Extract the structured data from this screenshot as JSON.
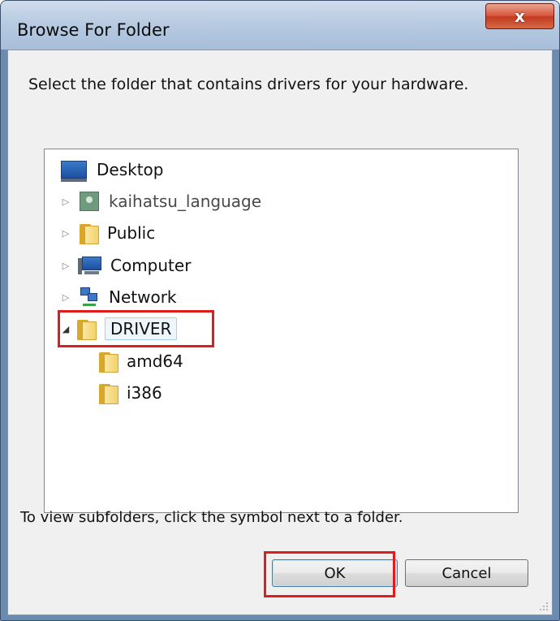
{
  "window": {
    "title": "Browse For Folder",
    "close_glyph": "x"
  },
  "instruction": "Select the folder that contains drivers for your hardware.",
  "tree": {
    "items": [
      {
        "label": "Desktop",
        "icon": "desktop-icon",
        "expander": ""
      },
      {
        "label": "kaihatsu_language",
        "icon": "user-folder-icon",
        "expander": "▷"
      },
      {
        "label": "Public",
        "icon": "folder-icon",
        "expander": "▷"
      },
      {
        "label": "Computer",
        "icon": "computer-icon",
        "expander": "▷"
      },
      {
        "label": "Network",
        "icon": "network-icon",
        "expander": "▷"
      },
      {
        "label": "DRIVER",
        "icon": "folder-icon",
        "expander": "◢",
        "selected": true
      },
      {
        "label": "amd64",
        "icon": "folder-icon",
        "expander": ""
      },
      {
        "label": "i386",
        "icon": "folder-icon",
        "expander": ""
      }
    ]
  },
  "hint": "To view subfolders, click the symbol next to a folder.",
  "buttons": {
    "ok": "OK",
    "cancel": "Cancel"
  },
  "colors": {
    "highlight": "#e11c1c",
    "selection_fill": "#eef6fc",
    "selection_border": "#9fd0f0"
  }
}
